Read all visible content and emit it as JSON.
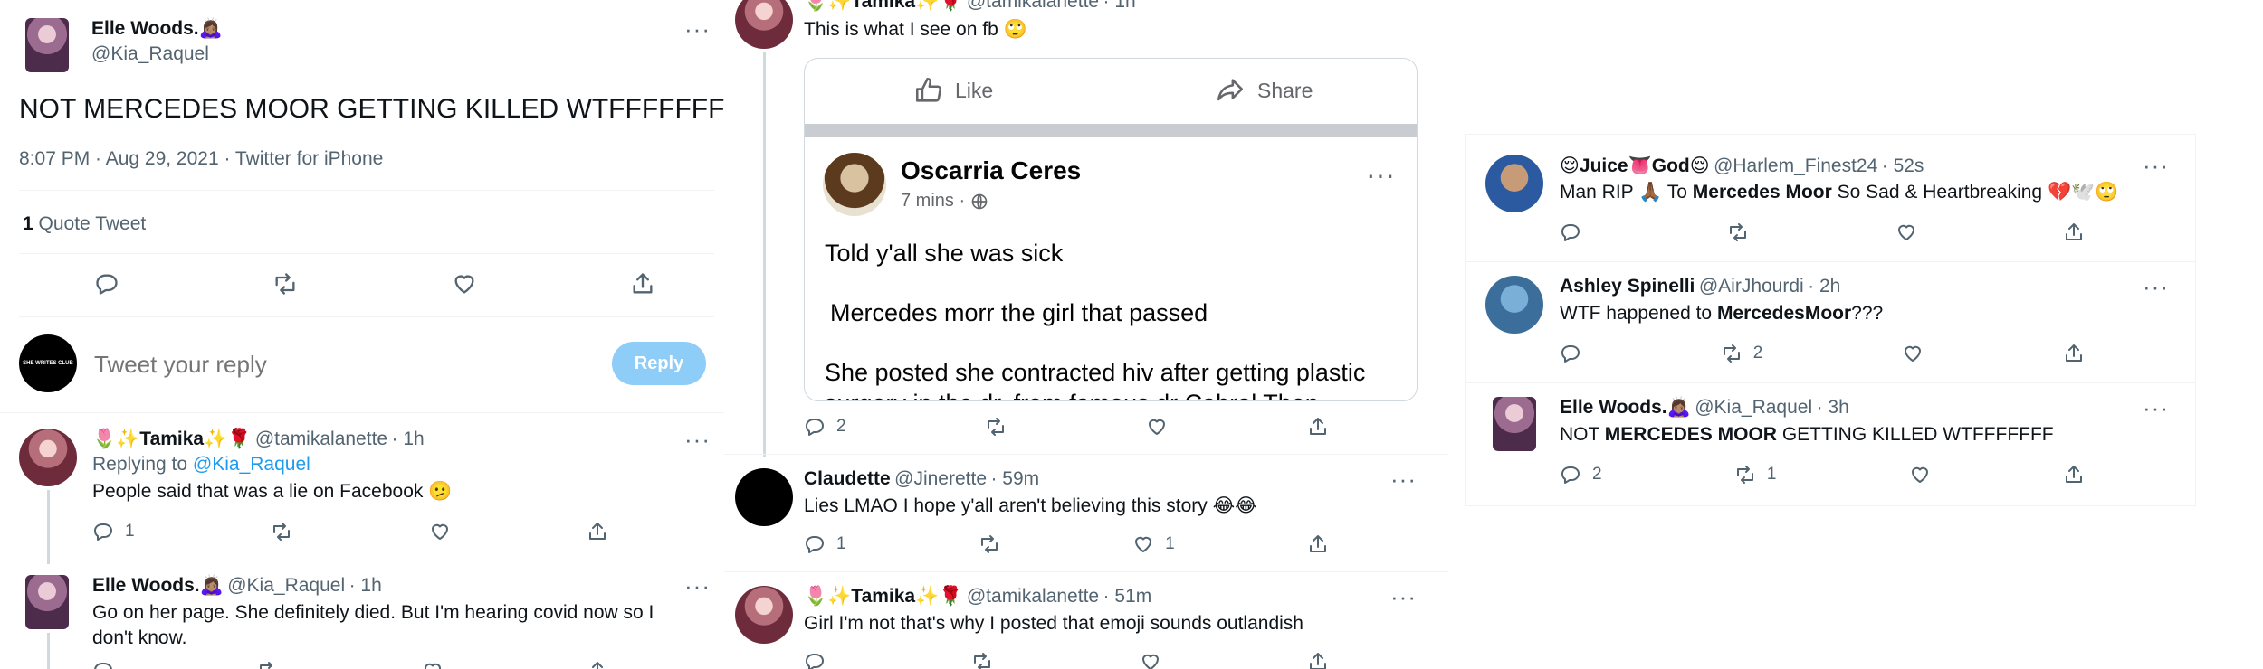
{
  "left": {
    "main_tweet": {
      "name": "Elle Woods.🙇🏽‍♀️",
      "handle": "@Kia_Raquel",
      "text": "NOT MERCEDES MOOR GETTING KILLED WTFFFFFFF",
      "meta": "8:07 PM · Aug 29, 2021 · Twitter for iPhone",
      "quote_count": "1",
      "quote_label": "Quote Tweet"
    },
    "reply_box": {
      "avatar_text": "SHE WRITES CLUB",
      "placeholder": "Tweet your reply",
      "button": "Reply"
    },
    "reply1": {
      "name": "🌷✨Tamika✨🌹",
      "handle": "@tamikalanette",
      "time": "· 1h",
      "replying_prefix": "Replying to",
      "replying_to": "@Kia_Raquel",
      "text": "People said that was a lie on Facebook 🫤",
      "reply_count": "1"
    },
    "reply2": {
      "name": "Elle Woods.🙇🏽‍♀️",
      "handle": "@Kia_Raquel",
      "time": "· 1h",
      "text": "Go on her page. She definitely died. But I'm hearing covid now so I don't know."
    }
  },
  "middle": {
    "top_tweet": {
      "name": "🌷✨Tamika✨🌹",
      "handle": "@tamikalanette",
      "time": "· 1h",
      "text": "This is what I see on fb 🙄",
      "reply_count": "2"
    },
    "fb_card": {
      "like": "Like",
      "share": "Share",
      "poster": "Oscarria Ceres",
      "post_time": "7 mins ·",
      "line1": "Told y'all she was sick",
      "line2": "Mercedes morr the girl that passed",
      "line3": "She posted she contracted hiv after getting plastic",
      "line4": "surgery in the dr. from famous dr Cabral Then"
    },
    "claudette": {
      "name": "Claudette",
      "handle": "@Jinerette",
      "time": "· 59m",
      "text": "Lies LMAO I hope y'all aren't believing this story 😂😂",
      "reply_count": "1",
      "like_count": "1"
    },
    "tamika2": {
      "name": "🌷✨Tamika✨🌹",
      "handle": "@tamikalanette",
      "time": "· 51m",
      "text": "Girl I'm not that's why I posted that emoji sounds outlandish"
    }
  },
  "right": {
    "juice": {
      "name": "😌Juice👅God😌",
      "handle": "@Harlem_Finest24",
      "time": "· 52s",
      "text_pre": "Man RIP 🙏🏾 To ",
      "text_bold": "Mercedes Moor",
      "text_post": " So Sad & Heartbreaking 💔🕊️🙄"
    },
    "ashley": {
      "name": "Ashley Spinelli",
      "handle": "@AirJhourdi",
      "time": "· 2h",
      "text_pre": "WTF happened to ",
      "text_bold": "MercedesMoor",
      "text_post": "???",
      "retweet_count": "2"
    },
    "elle": {
      "name": "Elle Woods.🙇🏽‍♀️",
      "handle": "@Kia_Raquel",
      "time": "· 3h",
      "text_pre": "NOT ",
      "text_bold": "MERCEDES MOOR",
      "text_post": " GETTING KILLED WTFFFFFFF",
      "reply_count": "2",
      "retweet_count": "1"
    }
  }
}
